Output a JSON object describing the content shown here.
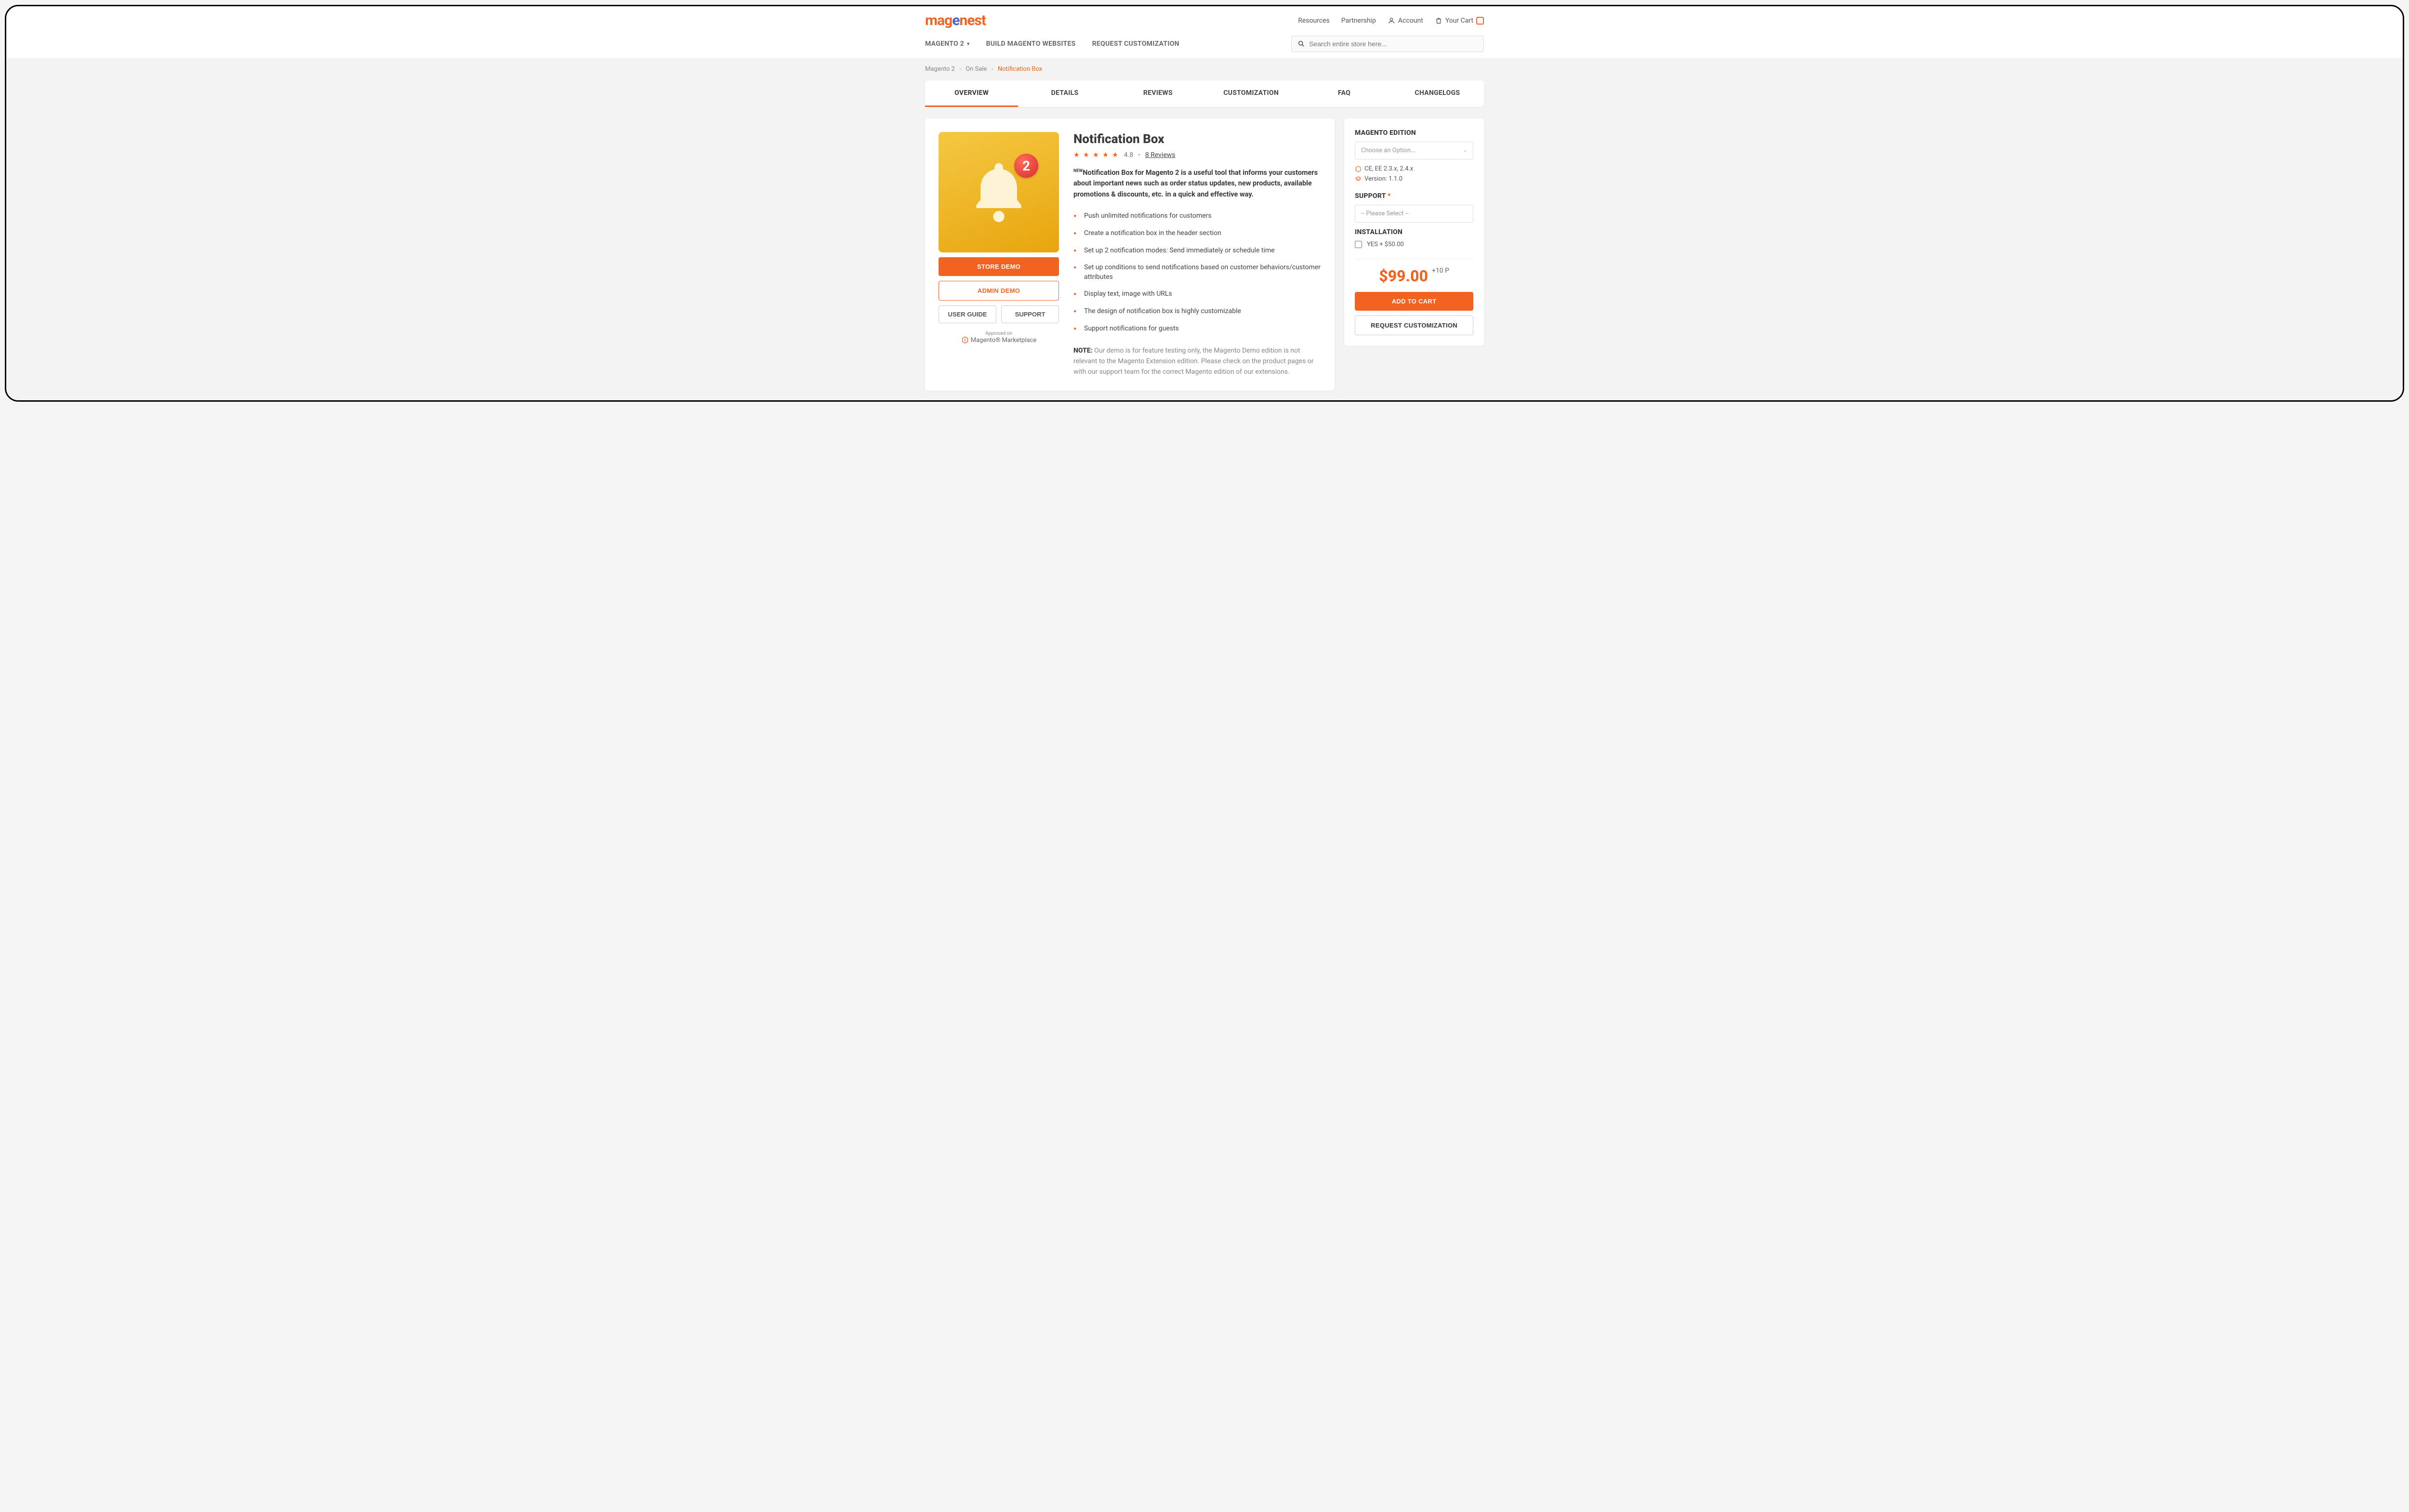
{
  "header": {
    "logo_part1": "mag",
    "logo_part2": "e",
    "logo_part3": "nest",
    "links": {
      "resources": "Resources",
      "partnership": "Partnership",
      "account": "Account",
      "cart": "Your Cart"
    },
    "nav": {
      "magento2": "MAGENTO 2",
      "build": "BUILD MAGENTO WEBSITES",
      "request": "REQUEST CUSTOMIZATION"
    },
    "search_placeholder": "Search entire store here..."
  },
  "breadcrumbs": {
    "c1": "Magento 2",
    "c2": "On Sale",
    "c3": "Notification Box"
  },
  "tabs": {
    "overview": "OVERVIEW",
    "details": "DETAILS",
    "reviews": "REVIEWS",
    "customization": "CUSTOMIZATION",
    "faq": "FAQ",
    "changelogs": "CHANGELOGS"
  },
  "product": {
    "badge_number": "2",
    "title": "Notification Box",
    "rating": "4.8",
    "reviews_link": "8  Reviews",
    "new_tag": "NEW",
    "description": "Notification Box for Magento 2 is a useful tool that informs your customers about important news such as order status updates, new products, available promotions & discounts, etc. in a quick and effective way.",
    "features": [
      "Push unlimited notifications for customers",
      "Create a notification box in the header section",
      "Set up 2 notification modes: Send immediately or schedule time",
      "Set up conditions to send notifications based on customer behaviors/customer attributes",
      "Display text, image with URLs",
      "The design of notification box is highly customizable",
      "Support notifications for guests"
    ],
    "note_label": "NOTE:",
    "note_text": " Our demo is for feature testing only, the Magento Demo edition is not relevant to the Magento Extension edition. Please check on the product pages or with our support team for the correct Magento edition of our extensions."
  },
  "left_buttons": {
    "store_demo": "STORE DEMO",
    "admin_demo": "ADMIN DEMO",
    "user_guide": "USER GUIDE",
    "support": "SUPPORT",
    "approved_small": "Approved on",
    "approved_main": "Magento® Marketplace"
  },
  "sidebar": {
    "edition_label": "MAGENTO EDITION",
    "edition_placeholder": "Choose an Option...",
    "compat": "CE, EE 2.3.x, 2.4.x",
    "version": "Version: 1.1.0",
    "support_label": "SUPPORT",
    "support_placeholder": "-- Please Select --",
    "installation_label": "INSTALLATION",
    "installation_option": "YES + $50.00",
    "price": "$99.00",
    "points": "+10 P",
    "add_to_cart": "ADD TO CART",
    "request_custom": "REQUEST CUSTOMIZATION"
  }
}
